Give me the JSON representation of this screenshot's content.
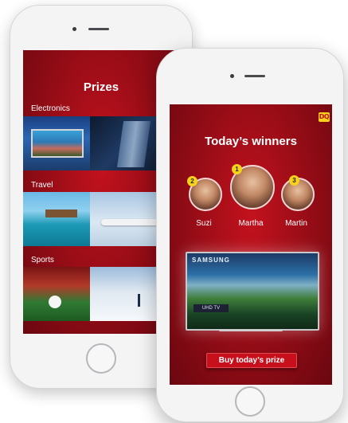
{
  "back_screen": {
    "logo": "DQ",
    "title": "Prizes",
    "categories": [
      {
        "label": "Electronics"
      },
      {
        "label": "Travel"
      },
      {
        "label": "Sports"
      }
    ]
  },
  "front_screen": {
    "logo": "DQ",
    "title": "Today’s winners",
    "winners": [
      {
        "rank": "2",
        "name": "Suzi"
      },
      {
        "rank": "1",
        "name": "Martha"
      },
      {
        "rank": "3",
        "name": "Martin"
      }
    ],
    "prize_brand": "SAMSUNG",
    "prize_badge": "UHD TV",
    "buy_label": "Buy today’s prize"
  },
  "colors": {
    "brand_red": "#c3121e",
    "logo_yellow": "#f7d21a"
  }
}
